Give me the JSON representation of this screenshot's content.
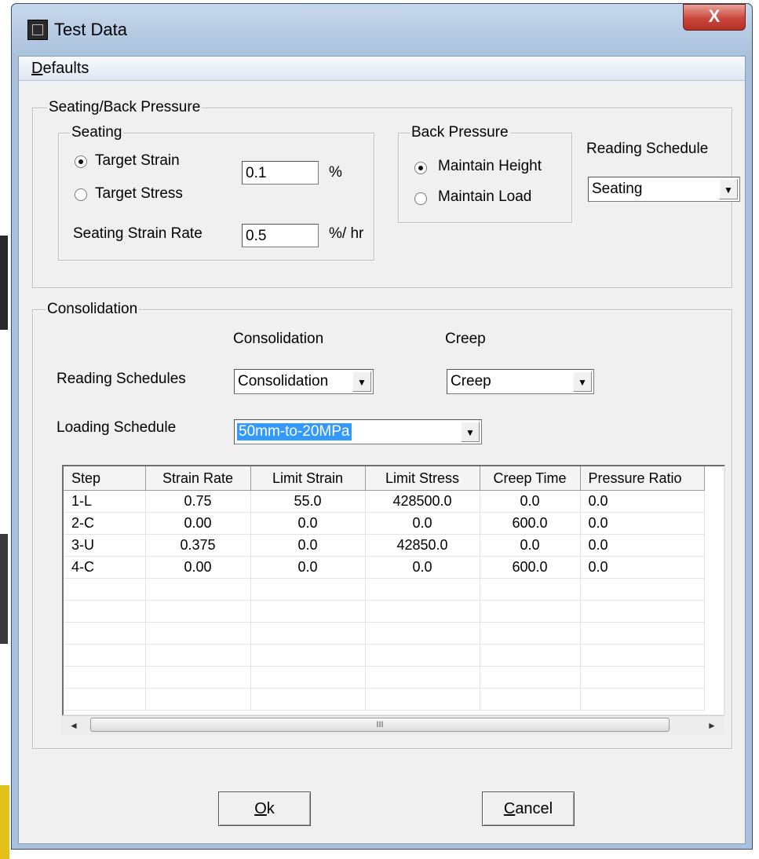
{
  "window": {
    "title": "Test Data",
    "close_glyph": "X"
  },
  "menu": {
    "defaults_accel": "D",
    "defaults_rest": "efaults"
  },
  "seating_back_pressure": {
    "group_label": "Seating/Back Pressure",
    "seating": {
      "group_label": "Seating",
      "target_strain_label": "Target Strain",
      "target_strain_selected": true,
      "target_stress_label": "Target Stress",
      "target_stress_selected": false,
      "target_value": "0.1",
      "target_unit": "%",
      "strain_rate_label": "Seating Strain Rate",
      "strain_rate_value": "0.5",
      "strain_rate_unit": "%/ hr"
    },
    "back_pressure": {
      "group_label": "Back Pressure",
      "maintain_height_label": "Maintain Height",
      "maintain_height_selected": true,
      "maintain_load_label": "Maintain Load",
      "maintain_load_selected": false
    },
    "reading_schedule": {
      "label": "Reading Schedule",
      "value": "Seating"
    }
  },
  "consolidation": {
    "group_label": "Consolidation",
    "col_consolidation_label": "Consolidation",
    "col_creep_label": "Creep",
    "reading_schedules_label": "Reading Schedules",
    "reading_consolidation_value": "Consolidation",
    "reading_creep_value": "Creep",
    "loading_schedule_label": "Loading Schedule",
    "loading_schedule_value": "50mm-to-20MPa",
    "table": {
      "columns": [
        "Step",
        "Strain Rate",
        "Limit Strain",
        "Limit Stress",
        "Creep Time",
        "Pressure Ratio"
      ],
      "rows": [
        [
          "1-L",
          "0.75",
          "55.0",
          "428500.0",
          "0.0",
          "0.0"
        ],
        [
          "2-C",
          "0.00",
          "0.0",
          "0.0",
          "600.0",
          "0.0"
        ],
        [
          "3-U",
          "0.375",
          "0.0",
          "42850.0",
          "0.0",
          "0.0"
        ],
        [
          "4-C",
          "0.00",
          "0.0",
          "0.0",
          "600.0",
          "0.0"
        ],
        [
          "",
          "",
          "",
          "",
          "",
          ""
        ],
        [
          "",
          "",
          "",
          "",
          "",
          ""
        ],
        [
          "",
          "",
          "",
          "",
          "",
          ""
        ],
        [
          "",
          "",
          "",
          "",
          "",
          ""
        ],
        [
          "",
          "",
          "",
          "",
          "",
          ""
        ],
        [
          "",
          "",
          "",
          "",
          "",
          ""
        ]
      ],
      "scroll_thumb_glyph": "III"
    }
  },
  "buttons": {
    "ok_accel": "O",
    "ok_rest": "k",
    "cancel_accel": "C",
    "cancel_rest": "ancel"
  }
}
